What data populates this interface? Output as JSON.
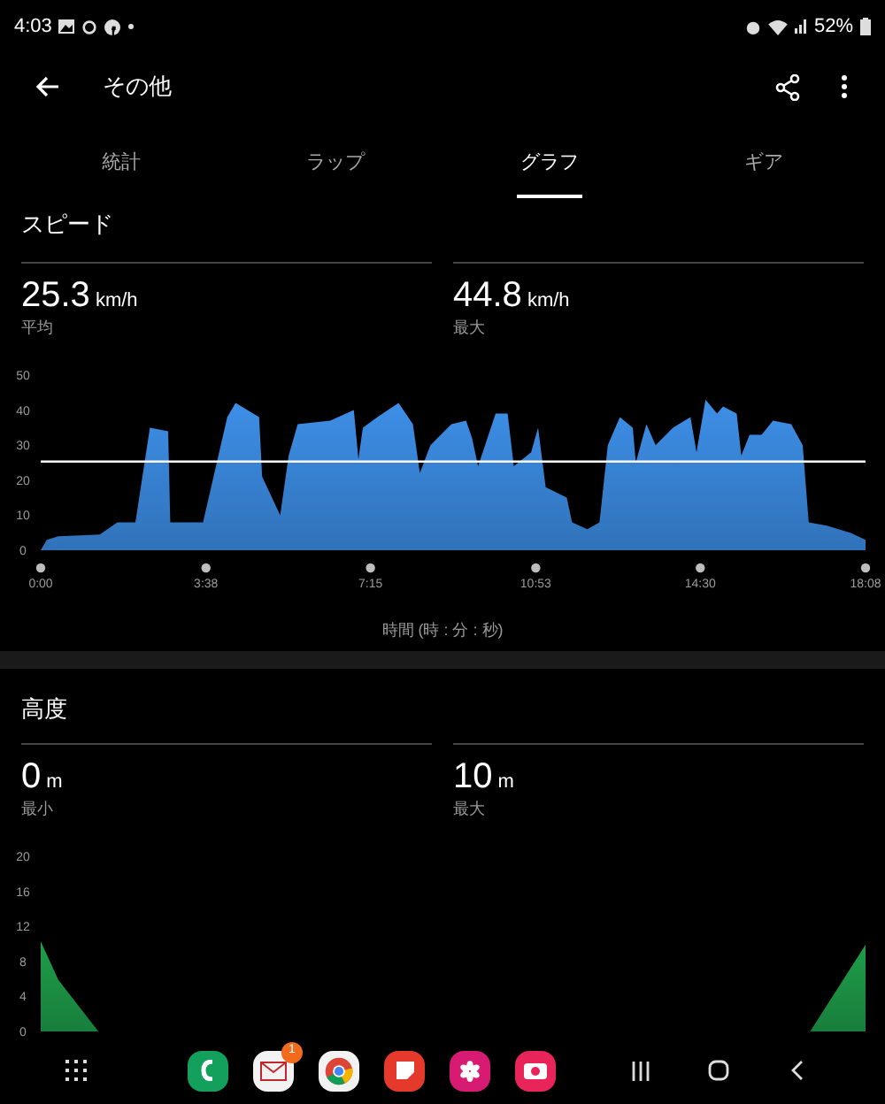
{
  "status_bar": {
    "time": "4:03",
    "battery": "52%"
  },
  "app_bar": {
    "title": "その他"
  },
  "tabs": [
    {
      "label": "統計",
      "selected": false
    },
    {
      "label": "ラップ",
      "selected": false
    },
    {
      "label": "グラフ",
      "selected": true
    },
    {
      "label": "ギア",
      "selected": false
    }
  ],
  "sections": [
    {
      "title": "スピード",
      "stats": [
        {
          "value": "25.3",
          "unit": "km/h",
          "label": "平均"
        },
        {
          "value": "44.8",
          "unit": "km/h",
          "label": "最大"
        }
      ],
      "chart_data": {
        "type": "area",
        "xlabel": "時間 (時 : 分 : 秒)",
        "x": [
          0,
          8,
          23,
          78,
          101,
          125,
          144,
          168,
          171,
          214,
          246,
          257,
          288,
          292,
          316,
          327,
          339,
          382,
          413,
          419,
          425,
          444,
          472,
          491,
          500,
          514,
          542,
          561,
          569,
          577,
          600,
          616,
          624,
          647,
          656,
          666,
          694,
          701,
          721,
          737,
          748,
          764,
          781,
          785,
          799,
          811,
          834,
          857,
          865,
          877,
          892,
          900,
          918,
          924,
          935,
          951,
          966,
          990,
          1005,
          1013,
          1037,
          1068,
          1088
        ],
        "series": [
          {
            "color": "#3d8fe8",
            "values": [
              0,
              3,
              4,
              4.5,
              8,
              8,
              35,
              34,
              8,
              8,
              38,
              42,
              38,
              21,
              10,
              27,
              36,
              37,
              40,
              26,
              35,
              38,
              42,
              36,
              22,
              30,
              36,
              37,
              32,
              24,
              39,
              39,
              24,
              28,
              35,
              18,
              15,
              8,
              6,
              8,
              30,
              38,
              35,
              25,
              36,
              30,
              35,
              38,
              28,
              43,
              39,
              41,
              39,
              27,
              33,
              33,
              37,
              36,
              30,
              8,
              7,
              5,
              3
            ]
          }
        ],
        "xlim": [
          0,
          1088
        ],
        "ylim": [
          0,
          50
        ],
        "xticks": [
          {
            "value": 0,
            "label": "0:00"
          },
          {
            "value": 218,
            "label": "3:38"
          },
          {
            "value": 435,
            "label": "7:15"
          },
          {
            "value": 653,
            "label": "10:53"
          },
          {
            "value": 870,
            "label": "14:30"
          },
          {
            "value": 1088,
            "label": "18:08"
          }
        ],
        "yticks": [
          0,
          10,
          20,
          30,
          40,
          50
        ],
        "ref_lines": [
          {
            "axis": "y",
            "value": 25.3
          }
        ]
      }
    },
    {
      "title": "高度",
      "stats": [
        {
          "value": "0",
          "unit": "m",
          "label": "最小"
        },
        {
          "value": "10",
          "unit": "m",
          "label": "最大"
        }
      ],
      "chart_data": {
        "type": "area",
        "x": [
          0,
          23,
          76,
          100,
          1000,
          1015,
          1088
        ],
        "series": [
          {
            "color": "#1e9e4a",
            "values": [
              10.3,
              5.9,
              0,
              0,
              0,
              0,
              9.9
            ]
          }
        ],
        "xlim": [
          0,
          1088
        ],
        "ylim": [
          0,
          20
        ],
        "yticks": [
          0,
          4,
          8,
          12,
          16,
          20
        ]
      }
    }
  ],
  "dock": {
    "mail_badge": "1"
  }
}
